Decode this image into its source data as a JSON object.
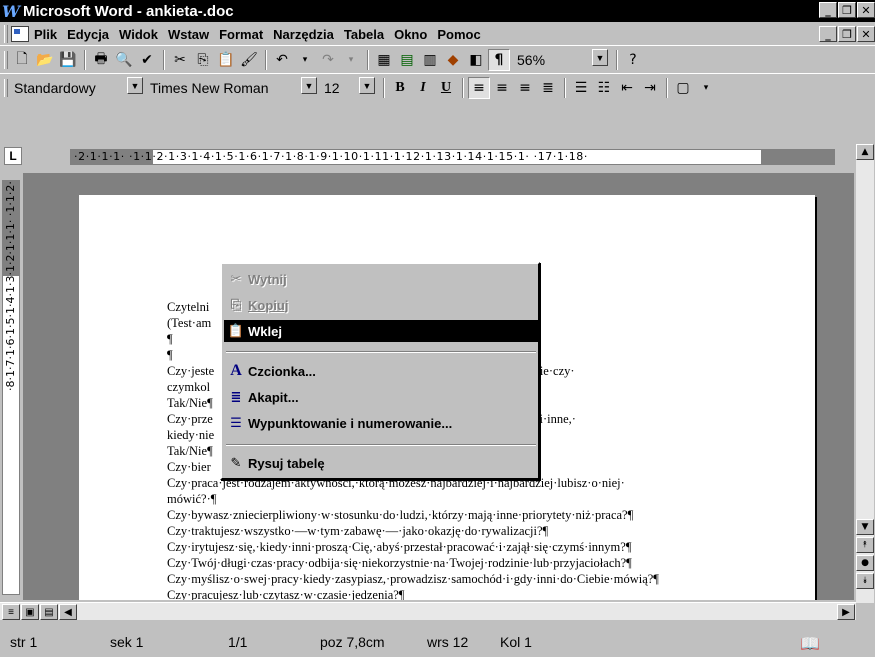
{
  "window": {
    "title": "Microsoft Word - ankieta-.doc",
    "minimize": "_",
    "restore": "❐",
    "close": "✕"
  },
  "menu": [
    "Plik",
    "Edycja",
    "Widok",
    "Wstaw",
    "Format",
    "Narzędzia",
    "Tabela",
    "Okno",
    "Pomoc"
  ],
  "toolbar": {
    "zoom": "56%",
    "style": "Standardowy",
    "font": "Times New Roman",
    "size": "12",
    "bold": "B",
    "italic": "I",
    "underline": "U",
    "pilcrow": "¶"
  },
  "ruler": {
    "horizontal": "·2·1·1·1·  ·1·1·2·1·3·1·4·1·5·1·6·1·7·1·8·1·9·1·10·1·11·1·12·1·13·1·14·1·15·1·  ·17·1·18·",
    "vertical": "·8·1·7·1·6·1·5·1·4·1·3·1·2·1·1·1·  ·1·1·2·"
  },
  "document": {
    "lines": [
      "Czytelni                                                                              )¶",
      "(Test·am",
      "¶",
      "¶",
      "Czy·jeste                                                                  iż·na·przykład·o·rodzinie·czy·",
      "czymkol",
      "Tak/Nie¶",
      "Czy·prze                                                                   racę·błyskawicznie·—·i·inne,·",
      "kiedy·nie",
      "Tak/Nie¶",
      "Czy·bier                                                                   cje?¶",
      "Czy·praca·jest·rodzajem·aktywności,·którą·możesz·najbardziej·i·najbardziej·lubisz·o·niej·",
      "mówić?·¶",
      "Czy·bywasz·zniecierpliwiony·w·stosunku·do·ludzi,·którzy·mają·inne·priorytety·niż·praca?¶",
      "Czy·traktujesz·wszystko·—w·tym·zabawę·—·jako·okazję·do·rywalizacji?¶",
      "Czy·irytujesz·się,·kiedy·inni·proszą·Cię,·abyś·przestał·pracować·i·zajął·się·czymś·innym?¶",
      "Czy·Twój·długi·czas·pracy·odbija·się·niekorzystnie·na·Twojej·rodzinie·lub·przyjaciołach?¶",
      "Czy·myślisz·o·swej·pracy·kiedy·zasypiasz,·prowadzisz·samochód·i·gdy·inni·do·Ciebie·mówią?¶",
      "Czy·pracujesz·lub·czytasz·w·czasie·jedzenia?¶"
    ]
  },
  "context_menu": {
    "cut": "Wytnij",
    "copy": "Kopiuj",
    "paste": "Wklej",
    "font": "Czcionka...",
    "paragraph": "Akapit...",
    "bullets": "Wypunktowanie i numerowanie...",
    "draw_table": "Rysuj tabelę"
  },
  "status": {
    "page": "str 1",
    "section": "sek 1",
    "pages": "1/1",
    "position": "poz 7,8cm",
    "line": "wrs 12",
    "column": "Kol 1"
  }
}
